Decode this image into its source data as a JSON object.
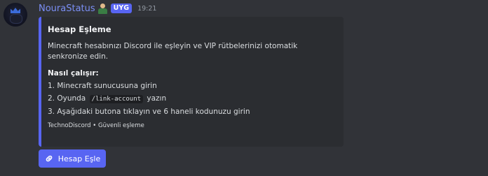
{
  "message": {
    "username": "NouraStatus",
    "user_emoji": "person-emoji",
    "app_tag": "UYG",
    "timestamp": "19:21"
  },
  "embed": {
    "accent_color": "#5865f2",
    "title": "Hesap Eşleme",
    "description": "Minecraft hesabınızı Discord ile eşleyin ve VIP rütbelerinizi otomatik senkronize edin.",
    "subtitle": "Nasıl çalışır:",
    "steps": {
      "step1": "1. Minecraft sunucusuna girin",
      "step2_prefix": "2. Oyunda",
      "step2_code": "/link-account",
      "step2_suffix": "yazın",
      "step3": "3. Aşağıdaki butona tıklayın ve 6 haneli kodunuzu girin"
    },
    "footer": "TechnoDiscord • Güvenli eşleme"
  },
  "button": {
    "label": "Hesap Eşle",
    "icon": "link-icon",
    "color": "#5865f2"
  }
}
